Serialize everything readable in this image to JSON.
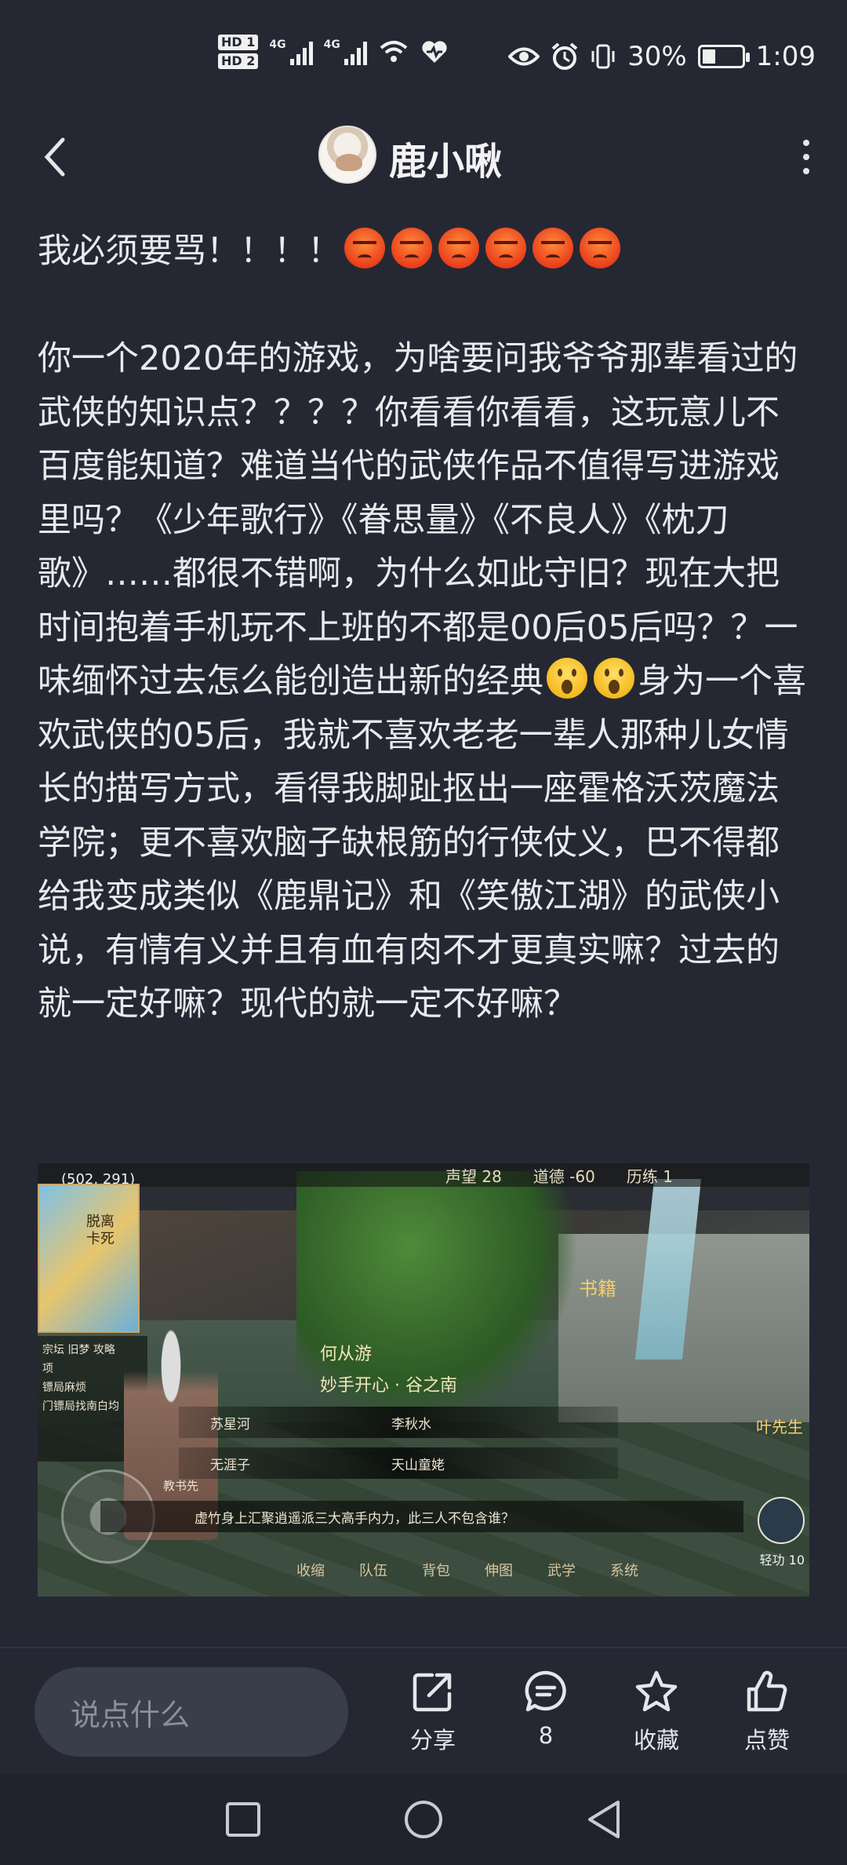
{
  "status_bar": {
    "hd1": "HD 1",
    "hd2": "HD 2",
    "net1": "4G",
    "net2": "4G",
    "battery": "30%",
    "time": "1:09",
    "icons": [
      "wifi-icon",
      "heart-pulse-icon",
      "eye-icon",
      "alarm-icon",
      "vibrate-icon",
      "battery-icon"
    ]
  },
  "header": {
    "username": "鹿小啾",
    "back_icon": "back-arrow-icon",
    "more_icon": "more-vertical-icon"
  },
  "post": {
    "line1": "我必须要骂！！！！",
    "angry_emoji_count": 6,
    "para_a": "你一个2020年的游戏，为啥要问我爷爷那辈看过的武侠的知识点？？？？你看看你看看，这玩意儿不百度能知道？难道当代的武侠作品不值得写进游戏里吗？《少年歌行》《眷思量》《不良人》《枕刀歌》……都很不错啊，为什么如此守旧？现在大把时间抱着手机玩不上班的不都是00后05后吗？？一味缅怀过去怎么能创造出新的经典",
    "para_b": "身为一个喜欢武侠的05后，我就不喜欢老老一辈人那种儿女情长的描写方式，看得我脚趾抠出一座霍格沃茨魔法学院；更不喜欢脑子缺根筋的行侠仗义，巴不得都给我变成类似《鹿鼎记》和《笑傲江湖》的武侠小说，有情有义并且有血有肉不才更真实嘛？过去的就一定好嘛？现代的就一定不好嘛？"
  },
  "game": {
    "coord": "(502, 291)",
    "hud": [
      "声望 28",
      "道德 -60",
      "历练 1"
    ],
    "map_labels": [
      "脱离",
      "卡死"
    ],
    "quest_tabs": "宗坛  旧梦  攻略",
    "quest_items": [
      "项",
      "镖局麻烦",
      "门镖局找南白均"
    ],
    "npc_name": "何从游",
    "dialog_title": "妙手开心 · 谷之南",
    "options_row1": [
      "苏星河",
      "李秋水"
    ],
    "options_row2": [
      "无涯子",
      "天山童姥"
    ],
    "npc_label": "教书先",
    "question": "虚竹身上汇聚逍遥派三大高手内力，此三人不包含谁？",
    "menu": [
      "收缩",
      "队伍",
      "背包",
      "伸图",
      "武学",
      "系统"
    ],
    "sign": "书籍",
    "right_npc": "叶先生",
    "skill_label": "轻功 10"
  },
  "bottom": {
    "input_placeholder": "说点什么",
    "share": "分享",
    "comments": "8",
    "favorite": "收藏",
    "like": "点赞"
  },
  "nav": {
    "icons": [
      "recent-apps-icon",
      "home-icon",
      "back-icon"
    ]
  }
}
